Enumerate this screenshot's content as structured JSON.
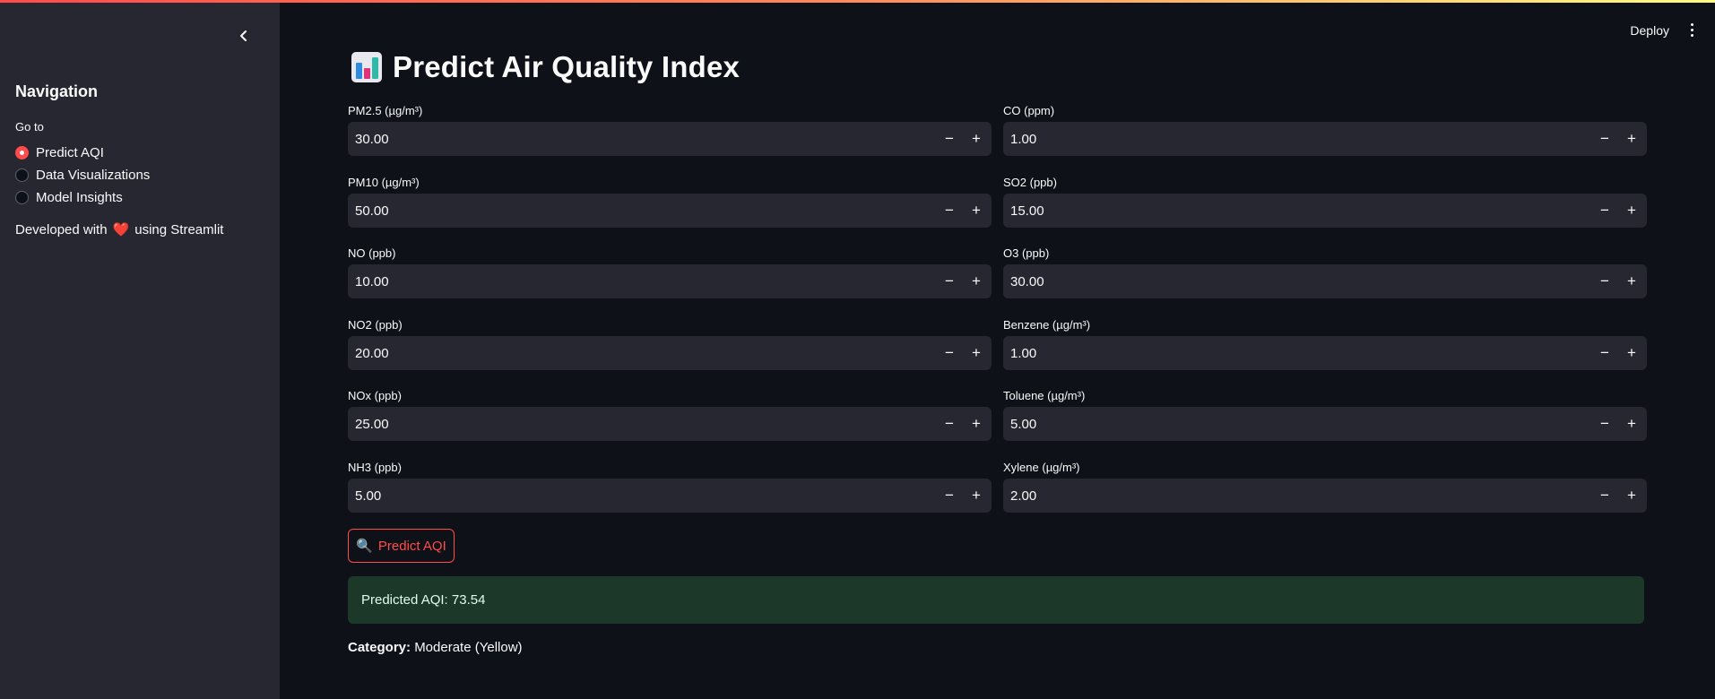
{
  "sidebar": {
    "nav_title": "Navigation",
    "goto_label": "Go to",
    "options": [
      {
        "label": "Predict AQI",
        "selected": true
      },
      {
        "label": "Data Visualizations",
        "selected": false
      },
      {
        "label": "Model Insights",
        "selected": false
      }
    ],
    "dev_prefix": "Developed with",
    "dev_suffix": "using Streamlit",
    "dev_icon": "heart-emoji",
    "collapse_icon": "chevron-left-icon"
  },
  "header": {
    "deploy_label": "Deploy",
    "menu_icon": "kebab-menu-icon"
  },
  "main": {
    "title": "Predict Air Quality Index",
    "title_icon": "bar-chart-emoji",
    "fields": [
      {
        "label": "PM2.5 (µg/m³)",
        "value": "30.00"
      },
      {
        "label": "CO (ppm)",
        "value": "1.00"
      },
      {
        "label": "PM10 (µg/m³)",
        "value": "50.00"
      },
      {
        "label": "SO2 (ppb)",
        "value": "15.00"
      },
      {
        "label": "NO (ppb)",
        "value": "10.00"
      },
      {
        "label": "O3 (ppb)",
        "value": "30.00"
      },
      {
        "label": "NO2 (ppb)",
        "value": "20.00"
      },
      {
        "label": "Benzene (µg/m³)",
        "value": "1.00"
      },
      {
        "label": "NOx (ppb)",
        "value": "25.00"
      },
      {
        "label": "Toluene (µg/m³)",
        "value": "5.00"
      },
      {
        "label": "NH3 (ppb)",
        "value": "5.00"
      },
      {
        "label": "Xylene (µg/m³)",
        "value": "2.00"
      }
    ],
    "stepper_minus": "−",
    "stepper_plus": "+",
    "predict_button_label": "Predict AQI",
    "predict_button_icon": "magnifier-emoji",
    "result_text": "Predicted AQI: 73.54",
    "category_label": "Category:",
    "category_value": "Moderate (Yellow)"
  },
  "colors": {
    "accent": "#ff4b4b",
    "sidebar_bg": "#262730",
    "app_bg": "#0e1117",
    "success_bg": "#1c3829"
  }
}
